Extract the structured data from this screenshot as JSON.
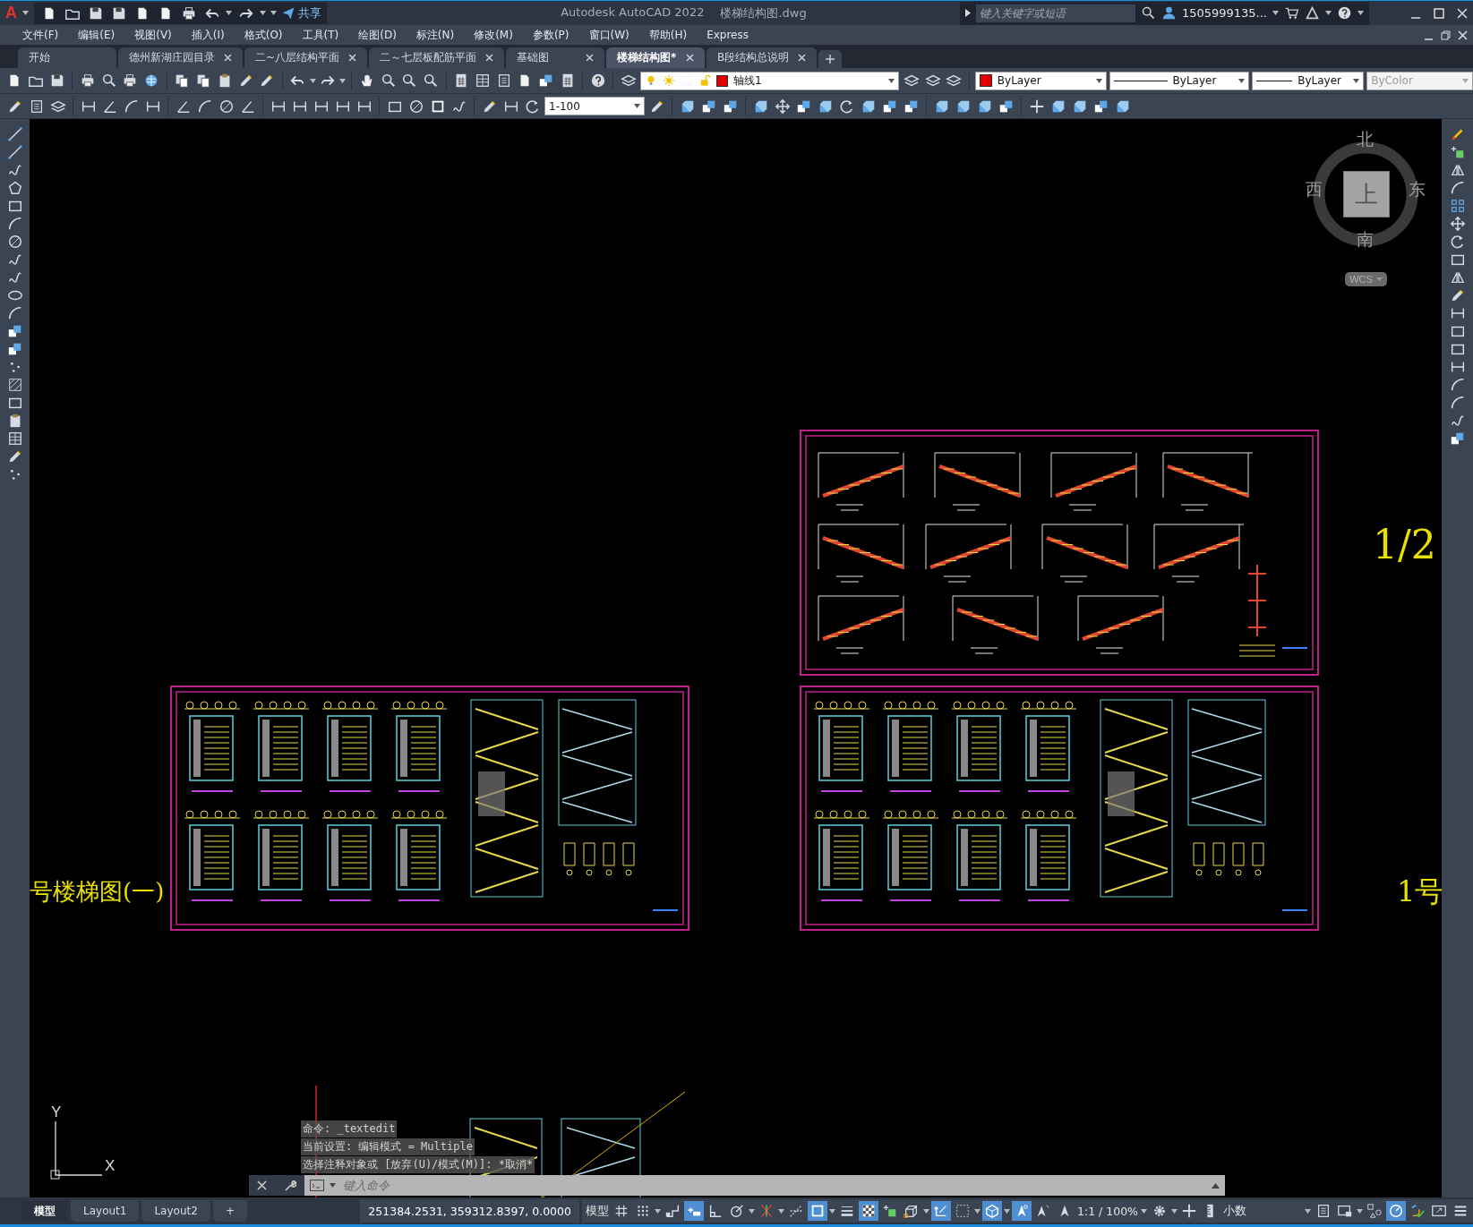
{
  "title_bar": {
    "logo": "A",
    "share": "共享",
    "app_title": "Autodesk AutoCAD 2022",
    "file_name": "楼梯结构图.dwg",
    "search": {
      "placeholder": "键入关键字或短语"
    },
    "user": "1505999135..."
  },
  "menu": [
    "文件(F)",
    "编辑(E)",
    "视图(V)",
    "插入(I)",
    "格式(O)",
    "工具(T)",
    "绘图(D)",
    "标注(N)",
    "修改(M)",
    "参数(P)",
    "窗口(W)",
    "帮助(H)",
    "Express"
  ],
  "file_tabs": [
    {
      "label": "开始",
      "selected": false,
      "closable": false
    },
    {
      "label": "德州新湖庄园目录",
      "selected": false,
      "closable": true
    },
    {
      "label": "二~八层结构平面",
      "selected": false,
      "closable": true
    },
    {
      "label": "二～七层板配筋平面",
      "selected": false,
      "closable": true
    },
    {
      "label": "基础图",
      "selected": false,
      "closable": true
    },
    {
      "label": "楼梯结构图*",
      "selected": true,
      "closable": true
    },
    {
      "label": "B段结构总说明",
      "selected": false,
      "closable": true
    }
  ],
  "properties_toolbar": {
    "layer": "轴线1",
    "color_setting": "ByLayer",
    "linetype": "ByLayer",
    "lineweight": "ByLayer",
    "plot_style": {
      "value": "ByColor",
      "disabled": true
    }
  },
  "dimension_toolbar": {
    "dim_style": "1-100"
  },
  "canvas": {
    "labels": [
      "1/2",
      "号楼梯图(一)",
      "1号"
    ],
    "viewcube": {
      "face": "上",
      "north": "北",
      "south": "南",
      "west": "西",
      "east": "东",
      "ucs": "WCS"
    },
    "ucs_axes": {
      "y": "Y",
      "x": "X"
    }
  },
  "command_line": {
    "history": [
      "命令: _textedit",
      "当前设置: 编辑模式 = Multiple",
      "选择注释对象或 [放弃(U)/模式(M)]: *取消*"
    ],
    "placeholder": "键入命令"
  },
  "status_bar": {
    "layout_tabs": [
      {
        "label": "模型",
        "selected": true
      },
      {
        "label": "Layout1",
        "selected": false
      },
      {
        "label": "Layout2",
        "selected": false
      }
    ],
    "add_tab": "+",
    "coordinates": "251384.2531, 359312.8397, 0.0000",
    "space": "模型",
    "annotation_scale": "1:1 / 100%",
    "units": "小数",
    "toggles": [
      {
        "kind": "grid",
        "on": false
      },
      {
        "kind": "snap",
        "on": false
      },
      {
        "kind": "infer",
        "on": false
      },
      {
        "kind": "dynamic-input",
        "on": true
      },
      {
        "kind": "ortho",
        "on": false
      },
      {
        "kind": "polar",
        "on": false
      },
      {
        "kind": "isodraft",
        "on": false
      },
      {
        "kind": "tracking",
        "on": false
      },
      {
        "kind": "osnap",
        "on": true
      },
      {
        "kind": "lineweight",
        "on": false
      },
      {
        "kind": "transparency",
        "on": true
      },
      {
        "kind": "cycling",
        "on": false
      },
      {
        "kind": "osnap3d",
        "on": false
      },
      {
        "kind": "dynucs",
        "on": true
      },
      {
        "kind": "selfilter",
        "on": false
      },
      {
        "kind": "gizmo",
        "on": true
      },
      {
        "kind": "annovis",
        "on": true
      },
      {
        "kind": "autoscale",
        "on": false
      },
      {
        "kind": "annoscale",
        "on": false
      }
    ],
    "tools": [
      {
        "kind": "gear",
        "on": false
      },
      {
        "kind": "plus",
        "on": false
      },
      {
        "kind": "ruler",
        "on": false
      },
      {
        "kind": "quickprops",
        "on": false
      },
      {
        "kind": "lockui",
        "on": false
      },
      {
        "kind": "isolate",
        "on": false
      },
      {
        "kind": "hardware",
        "on": true
      },
      {
        "kind": "cleanscreen",
        "on": false
      },
      {
        "kind": "fullscreen",
        "on": false
      },
      {
        "kind": "menu",
        "on": false
      }
    ]
  }
}
